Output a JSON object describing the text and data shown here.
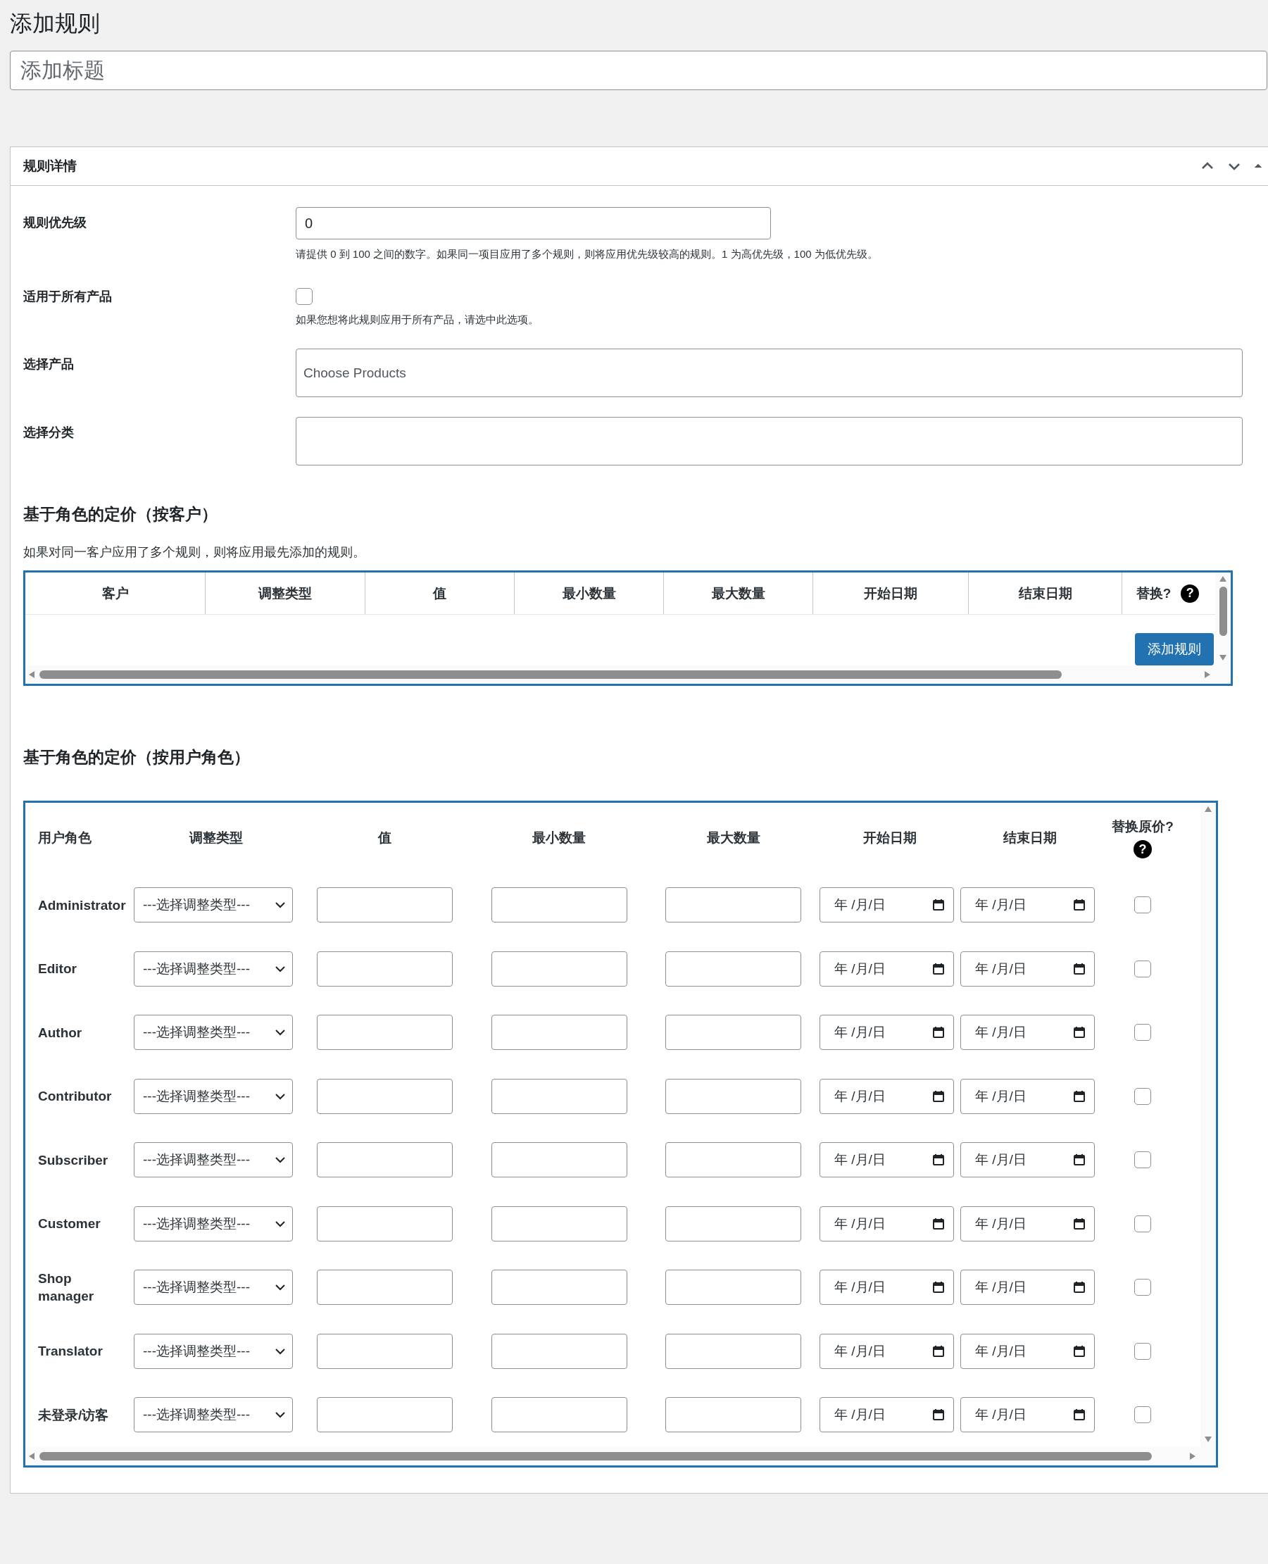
{
  "page_title": "添加规则",
  "title_field": {
    "placeholder": "添加标题"
  },
  "panel": {
    "title": "规则详情"
  },
  "fields": [
    {
      "kind": "text",
      "label": "规则优先级",
      "value": "0",
      "help": "请提供 0 到 100 之间的数字。如果同一项目应用了多个规则，则将应用优先级较高的规则。1 为高优先级，100 为低优先级。"
    },
    {
      "kind": "checkbox",
      "label": "适用于所有产品",
      "checked": false,
      "help": "如果您想将此规则应用于所有产品，请选中此选项。"
    },
    {
      "kind": "multiselect",
      "label": "选择产品",
      "placeholder": "Choose Products"
    },
    {
      "kind": "multiselect",
      "label": "选择分类"
    }
  ],
  "customer_section": {
    "heading": "基于角色的定价（按客户）",
    "description": "如果对同一客户应用了多个规则，则将应用最先添加的规则。",
    "columns": [
      "客户",
      "调整类型",
      "值",
      "最小数量",
      "最大数量",
      "开始日期",
      "结束日期",
      "替换?"
    ],
    "help_mark": "?",
    "button": "添加规则"
  },
  "role_section": {
    "heading": "基于角色的定价（按用户角色）",
    "columns": [
      "用户角色",
      "调整类型",
      "值",
      "最小数量",
      "最大数量",
      "开始日期",
      "结束日期",
      "替换原价?"
    ],
    "help_mark": "?",
    "rows": [
      {
        "role": "Administrator",
        "adjustment": "---选择调整类型---",
        "start_date": "年 /月/日",
        "end_date": "年 /月/日",
        "replace": false
      },
      {
        "role": "Editor",
        "adjustment": "---选择调整类型---",
        "start_date": "年 /月/日",
        "end_date": "年 /月/日",
        "replace": false
      },
      {
        "role": "Author",
        "adjustment": "---选择调整类型---",
        "start_date": "年 /月/日",
        "end_date": "年 /月/日",
        "replace": false
      },
      {
        "role": "Contributor",
        "adjustment": "---选择调整类型---",
        "start_date": "年 /月/日",
        "end_date": "年 /月/日",
        "replace": false
      },
      {
        "role": "Subscriber",
        "adjustment": "---选择调整类型---",
        "start_date": "年 /月/日",
        "end_date": "年 /月/日",
        "replace": false
      },
      {
        "role": "Customer",
        "adjustment": "---选择调整类型---",
        "start_date": "年 /月/日",
        "end_date": "年 /月/日",
        "replace": false
      },
      {
        "role": "Shop manager",
        "adjustment": "---选择调整类型---",
        "start_date": "年 /月/日",
        "end_date": "年 /月/日",
        "replace": false
      },
      {
        "role": "Translator",
        "adjustment": "---选择调整类型---",
        "start_date": "年 /月/日",
        "end_date": "年 /月/日",
        "replace": false
      },
      {
        "role": "未登录/访客",
        "adjustment": "---选择调整类型---",
        "start_date": "年 /月/日",
        "end_date": "年 /月/日",
        "replace": false
      }
    ]
  }
}
